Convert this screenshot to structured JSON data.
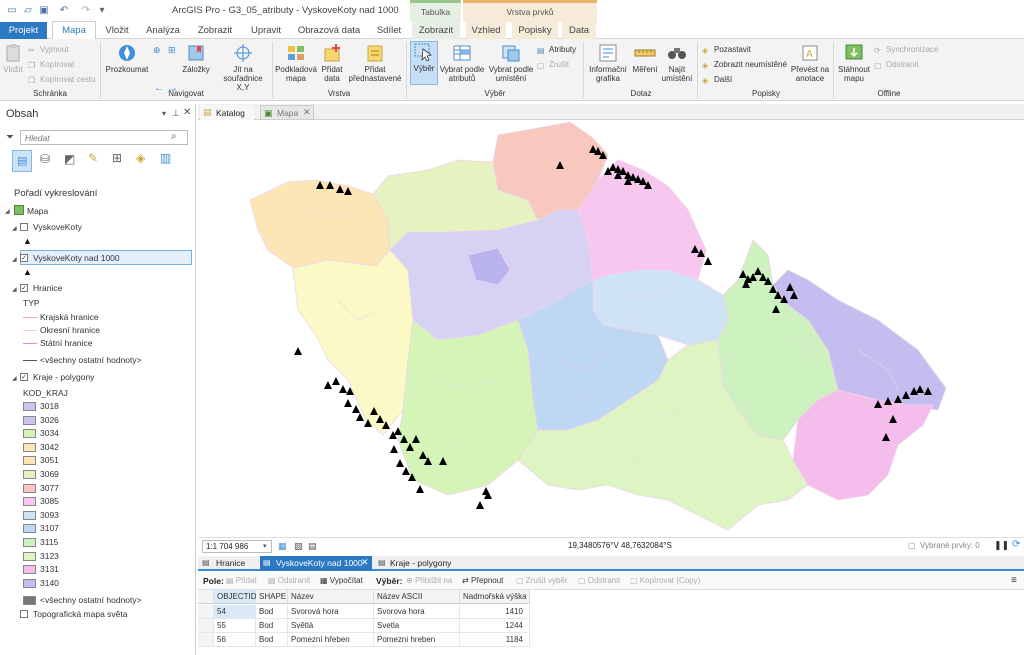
{
  "window": {
    "title": "ArcGIS Pro - G3_05_atributy - VyskoveKoty nad 1000"
  },
  "context_tabs": {
    "table_group": "Tabulka",
    "layer_group": "Vrstva prvků"
  },
  "tabs": [
    {
      "label": "Projekt"
    },
    {
      "label": "Mapa"
    },
    {
      "label": "Vložit"
    },
    {
      "label": "Analýza"
    },
    {
      "label": "Zobrazit"
    },
    {
      "label": "Upravit"
    },
    {
      "label": "Obrazová data"
    },
    {
      "label": "Sdílet"
    },
    {
      "label": "Zobrazit"
    },
    {
      "label": "Vzhled"
    },
    {
      "label": "Popisky"
    },
    {
      "label": "Data"
    }
  ],
  "ribbon": {
    "clipboard": {
      "paste": "Vložit",
      "cut": "Vyjmout",
      "copy": "Kopírovat",
      "copy_path": "Kopírovat cestu",
      "group": "Schránka"
    },
    "navigate": {
      "explore": "Prozkoumat",
      "bookmarks": "Záložky",
      "goto_xy": "Jít na souřadnice X,Y",
      "group": "Navigovat"
    },
    "layer": {
      "basemap": "Podkladová mapa",
      "add_data": "Přidat data",
      "add_preset": "Přidat přednastavené",
      "group": "Vrstva"
    },
    "selection": {
      "select": "Výběr",
      "by_attr": "Vybrat podle atributů",
      "by_loc": "Vybrat podle umístění",
      "attributes": "Atributy",
      "clear": "Zrušit",
      "group": "Výběr"
    },
    "inquiry": {
      "info_graphics": "Informační grafika",
      "measure": "Měření",
      "locate": "Najít umístění",
      "group": "Dotaz"
    },
    "labeling": {
      "pause": "Pozastavit",
      "view_unplaced": "Zobrazit neumístěné",
      "more": "Další",
      "convert": "Převést na anotace",
      "group": "Popisky"
    },
    "offline": {
      "download": "Stáhnout mapu",
      "sync": "Synchronizace",
      "remove": "Odstranit",
      "group": "Offline"
    }
  },
  "contents": {
    "title": "Obsah",
    "search_placeholder": "Hledat",
    "draw_order": "Pořadí vykreslování",
    "map": "Mapa",
    "layers": {
      "vyskove": "VyskoveKoty",
      "vyskove1000": "VyskoveKoty nad 1000",
      "hranice": "Hranice",
      "typ": "TYP",
      "hranice_items": [
        "Krajská hranice",
        "Okresní hranice",
        "Státní hranice",
        "<všechny ostatní hodnoty>"
      ],
      "kraje": "Kraje - polygony",
      "kod_kraj": "KOD_KRAJ",
      "kraje_items": [
        {
          "label": "3018",
          "color": "#c9c5f0"
        },
        {
          "label": "3026",
          "color": "#c9c5f0"
        },
        {
          "label": "3034",
          "color": "#d5f5b8"
        },
        {
          "label": "3042",
          "color": "#fde6b5"
        },
        {
          "label": "3051",
          "color": "#fde6b5"
        },
        {
          "label": "3069",
          "color": "#e6f3c0"
        },
        {
          "label": "3077",
          "color": "#f8c7bd"
        },
        {
          "label": "3085",
          "color": "#f7c7ef"
        },
        {
          "label": "3093",
          "color": "#cfe3f6"
        },
        {
          "label": "3107",
          "color": "#bed7f2"
        },
        {
          "label": "3115",
          "color": "#cdf2bf"
        },
        {
          "label": "3123",
          "color": "#dcf5c2"
        },
        {
          "label": "3131",
          "color": "#f5bdec"
        },
        {
          "label": "3140",
          "color": "#c4bdf0"
        },
        {
          "label": "<všechny ostatní hodnoty>",
          "color": "#777777"
        }
      ],
      "topo": "Topografická mapa světa"
    }
  },
  "view_tabs": {
    "catalog": "Katalog",
    "map": "Mapa"
  },
  "status": {
    "scale": "1:1 704 986",
    "coords": "19,3480576°V 48,7632084°S",
    "selected": "Vybrané prvky: 0"
  },
  "table_tabs": {
    "hranice": "Hranice",
    "vyskove1000": "VyskoveKoty nad 1000",
    "kraje": "Kraje - polygony"
  },
  "table_toolbar": {
    "field_label": "Pole:",
    "add": "Přidat",
    "delete": "Odstranit",
    "calculate": "Vypočítat",
    "selection_label": "Výběr:",
    "zoom_to": "Přiblížit na",
    "switch": "Přepnout",
    "clear": "Zrušit výběr",
    "delete_sel": "Odstranit",
    "copy": "Kopírovat (Copy)"
  },
  "table": {
    "columns": [
      "OBJECTID",
      "SHAPE",
      "Název",
      "Název ASCII",
      "Nadmořská výška"
    ],
    "rows": [
      [
        "54",
        "Bod",
        "Svorová hora",
        "Svorova hora",
        "1410"
      ],
      [
        "55",
        "Bod",
        "Světlá",
        "Svetla",
        "1244"
      ],
      [
        "56",
        "Bod",
        "Pomezní hřeben",
        "Pomezni hreben",
        "1184"
      ]
    ]
  }
}
